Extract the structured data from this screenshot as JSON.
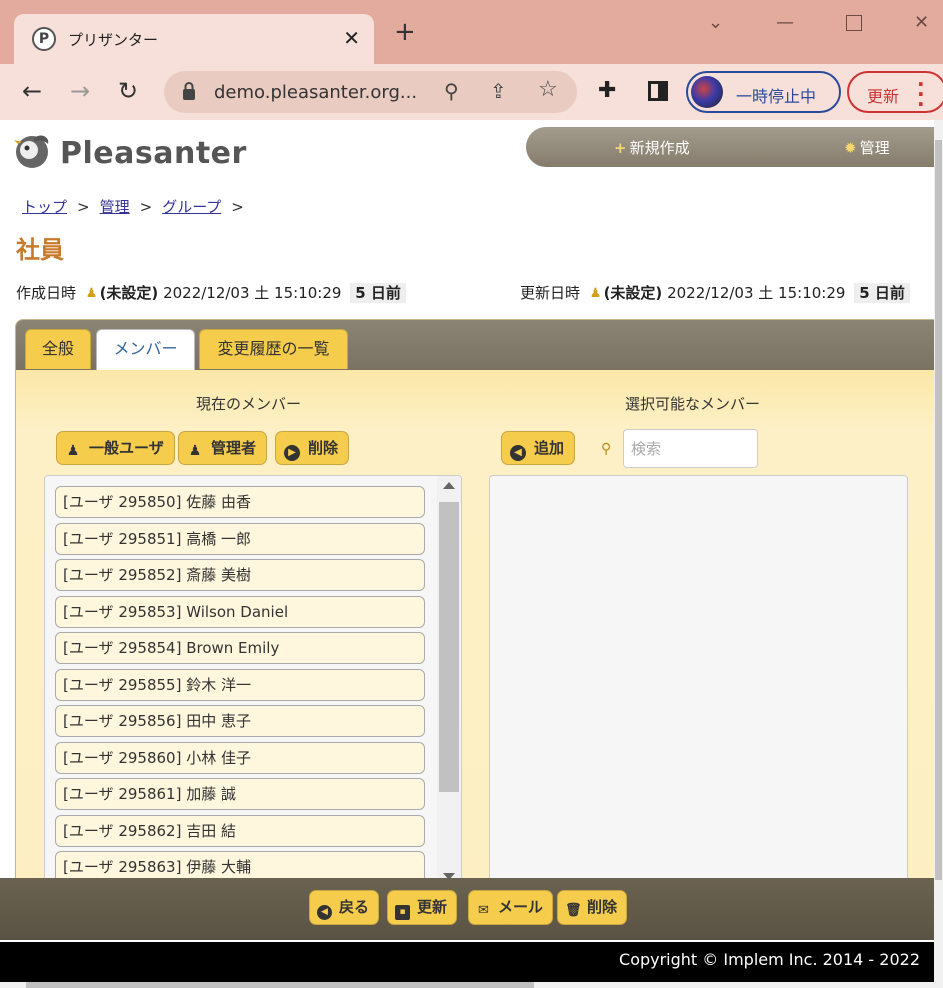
{
  "browser": {
    "tab_title": "プリザンター",
    "favicon_letter": "P",
    "url": "demo.pleasanter.org...",
    "profile_status": "一時停止中",
    "update_label": "更新"
  },
  "header": {
    "logo_text": "Pleasanter",
    "nav_new": "新規作成",
    "nav_manage": "管理"
  },
  "breadcrumb": [
    {
      "label": "トップ"
    },
    {
      "label": "管理"
    },
    {
      "label": "グループ"
    }
  ],
  "breadcrumb_sep": ">",
  "page_title": "社員",
  "meta": {
    "created_label": "作成日時",
    "created_user": "(未設定)",
    "created_datetime": "2022/12/03 土 15:10:29",
    "created_ago": "5 日前",
    "updated_label": "更新日時",
    "updated_user": "(未設定)",
    "updated_datetime": "2022/12/03 土 15:10:29",
    "updated_ago": "5 日前"
  },
  "tabs": [
    {
      "label": "全般"
    },
    {
      "label": "メンバー"
    },
    {
      "label": "変更履歴の一覧"
    }
  ],
  "active_tab": "メンバー",
  "current_members": {
    "title": "現在のメンバー",
    "buttons": {
      "general_user": "一般ユーザ",
      "admin": "管理者",
      "delete": "削除"
    },
    "items": [
      "[ユーザ 295850] 佐藤 由香",
      "[ユーザ 295851] 高橋 一郎",
      "[ユーザ 295852] 斎藤 美樹",
      "[ユーザ 295853] Wilson Daniel",
      "[ユーザ 295854] Brown Emily",
      "[ユーザ 295855] 鈴木 洋一",
      "[ユーザ 295856] 田中 恵子",
      "[ユーザ 295860] 小林 佳子",
      "[ユーザ 295861] 加藤 誠",
      "[ユーザ 295862] 吉田 結",
      "[ユーザ 295863] 伊藤 大輔"
    ]
  },
  "available_members": {
    "title": "選択可能なメンバー",
    "add_label": "追加",
    "search_placeholder": "検索"
  },
  "footer_buttons": {
    "back": "戻る",
    "update": "更新",
    "mail": "メール",
    "delete": "削除"
  },
  "copyright": "Copyright © Implem Inc. 2014 - 2022",
  "colors": {
    "accent_yellow": "#f6cc4d",
    "title_orange": "#c8792a",
    "tab_bar": "#e2ab9e"
  }
}
